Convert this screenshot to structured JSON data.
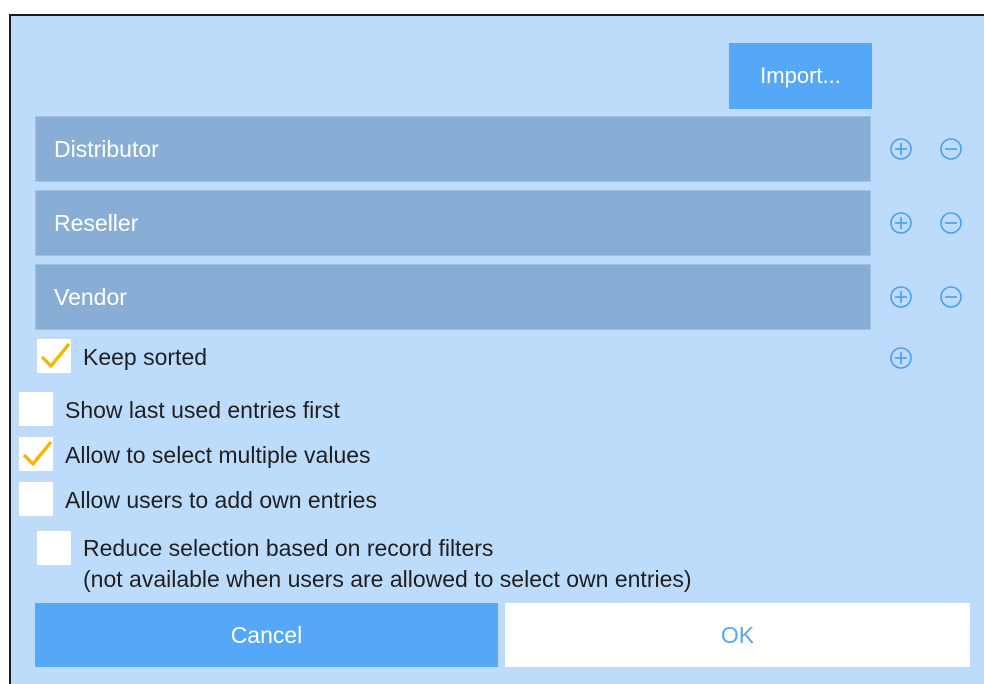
{
  "toolbar": {
    "import_label": "Import..."
  },
  "entries": [
    {
      "label": "Distributor"
    },
    {
      "label": "Reseller"
    },
    {
      "label": "Vendor"
    }
  ],
  "options": {
    "keep_sorted": {
      "label": "Keep sorted",
      "checked": true
    },
    "show_last_used": {
      "label": "Show last used entries first",
      "checked": false
    },
    "allow_multiple": {
      "label": "Allow to select multiple values",
      "checked": true
    },
    "allow_own_entries": {
      "label": "Allow users to add own entries",
      "checked": false
    },
    "reduce_selection": {
      "label_line1": "Reduce selection based on record filters",
      "label_line2": "(not available when users are allowed to select own entries)",
      "checked": false
    }
  },
  "footer": {
    "cancel_label": "Cancel",
    "ok_label": "OK"
  },
  "colors": {
    "dialog_bg": "#bddcfb",
    "accent": "#55a8f7",
    "entry_bg": "#88aed6",
    "checkmark": "#f5b800"
  }
}
